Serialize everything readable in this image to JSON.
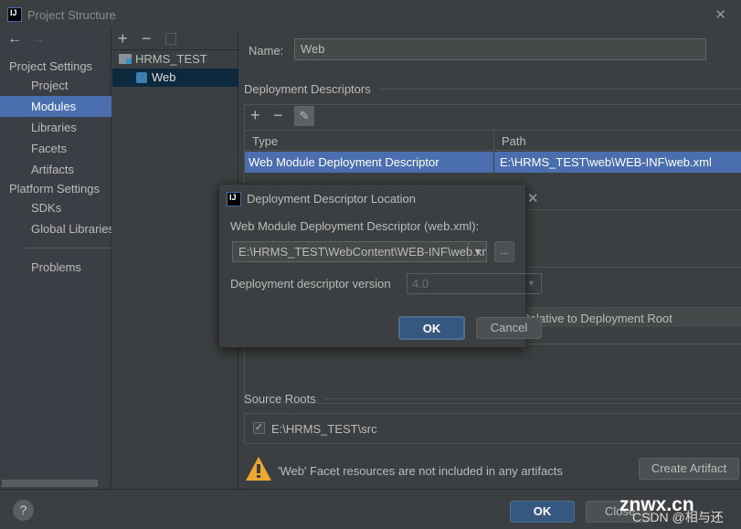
{
  "window": {
    "title": "Project Structure",
    "close": "✕"
  },
  "nav": {
    "back": "←",
    "forward": "→"
  },
  "sidebar": {
    "project_settings": "Project Settings",
    "items1": [
      {
        "label": "Project"
      },
      {
        "label": "Modules"
      },
      {
        "label": "Libraries"
      },
      {
        "label": "Facets"
      },
      {
        "label": "Artifacts"
      }
    ],
    "platform_settings": "Platform Settings",
    "items2": [
      {
        "label": "SDKs"
      },
      {
        "label": "Global Libraries"
      }
    ],
    "problems": "Problems"
  },
  "tree": {
    "add": "+",
    "remove": "−",
    "root": "HRMS_TEST",
    "child": "Web"
  },
  "main": {
    "name_label": "Name:",
    "name_value": "Web",
    "deployment_descriptors": "Deployment Descriptors",
    "table": {
      "headers": [
        "Type",
        "Path"
      ],
      "rows": [
        [
          "Web Module Deployment Descriptor",
          "E:\\HRMS_TEST\\web\\WEB-INF\\web.xml"
        ]
      ]
    },
    "hidden_header": "Path Relative to Deployment Root",
    "source_roots": "Source Roots",
    "source_root_path": "E:\\HRMS_TEST\\src",
    "warning": "'Web' Facet resources are not included in any artifacts",
    "create_artifact": "Create Artifact"
  },
  "dialog": {
    "title": "Deployment Descriptor Location",
    "close": "✕",
    "field_label": "Web Module Deployment Descriptor (web.xml):",
    "field_value": "E:\\HRMS_TEST\\WebContent\\WEB-INF\\web.xml",
    "browse": "...",
    "version_label": "Deployment descriptor version",
    "version_value": "4.0",
    "ok": "OK",
    "cancel": "Cancel"
  },
  "footer": {
    "help": "?",
    "ok": "OK",
    "close": "Close"
  },
  "watermark": {
    "site": "znwx.cn",
    "csdn": "CSDN @相与还"
  },
  "colors": {
    "selection": "#4b6eaf",
    "tree_selection": "#0d293e",
    "ok_button": "#365880",
    "warning": "#f0a732"
  }
}
